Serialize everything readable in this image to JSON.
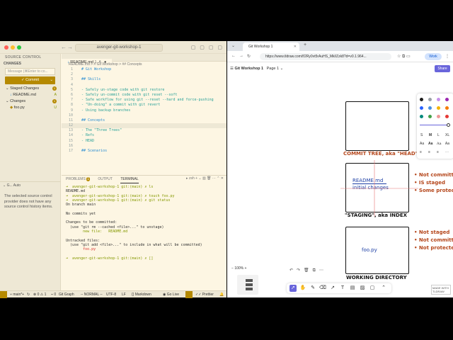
{
  "vscode": {
    "command_center": "avenger-git-workshop-1",
    "sidebar": {
      "title": "SOURCE CONTROL",
      "section": "CHANGES",
      "message_placeholder": "Message (⌘Enter to co...",
      "commit_label": "Commit",
      "staged_label": "Staged Changes",
      "staged_count": "1",
      "staged_file": "README.md",
      "staged_status": "A",
      "changes_label": "Changes",
      "changes_count": "1",
      "changes_file": "foo.py",
      "changes_status": "U",
      "graph_header": "G... Auto",
      "graph_message": "The selected source control provider does not have any source control history items."
    },
    "editor": {
      "tab_label": "README.md",
      "tab_status": "1, A",
      "breadcrumb": "README.md > # Git Workshop > ## Concepts",
      "lines": [
        {
          "n": "1",
          "t": "# Git Workshop",
          "k": "hd"
        },
        {
          "n": "2",
          "t": "",
          "k": ""
        },
        {
          "n": "3",
          "t": "## Skills",
          "k": "hd"
        },
        {
          "n": "4",
          "t": "",
          "k": ""
        },
        {
          "n": "5",
          "t": "- Safely un-stage code with git restore",
          "k": "li"
        },
        {
          "n": "6",
          "t": "- Safely un-commit code with git reset --soft",
          "k": "li"
        },
        {
          "n": "7",
          "t": "- Safe workflow for using git --reset --hard and force-pushing",
          "k": "li"
        },
        {
          "n": "8",
          "t": "- \"Un-doing\" a commit with git revert",
          "k": "li"
        },
        {
          "n": "9",
          "t": "- Using backup branches",
          "k": "li"
        },
        {
          "n": "10",
          "t": "",
          "k": ""
        },
        {
          "n": "11",
          "t": "## Concepts",
          "k": "hd"
        },
        {
          "n": "12",
          "t": "",
          "k": ""
        },
        {
          "n": "13",
          "t": "- The \"Three Trees\"",
          "k": "li"
        },
        {
          "n": "14",
          "t": "- Refs",
          "k": "li"
        },
        {
          "n": "15",
          "t": "- HEAD",
          "k": "li"
        },
        {
          "n": "16",
          "t": "",
          "k": ""
        },
        {
          "n": "17",
          "t": "## Scenarios",
          "k": "hd"
        }
      ]
    },
    "panel": {
      "tabs": [
        "PROBLEMS",
        "OUTPUT",
        "TERMINAL"
      ],
      "problems_count": "1",
      "shell": "zsh",
      "terminal": [
        {
          "t": "➜  avenger-git-workshop-1 git:(main) ✗ ls",
          "k": "g"
        },
        {
          "t": "README.md",
          "k": ""
        },
        {
          "t": "➜  avenger-git-workshop-1 git:(main) ✗ touch foo.py",
          "k": "g"
        },
        {
          "t": "➜  avenger-git-workshop-1 git:(main) ✗ git status",
          "k": "g"
        },
        {
          "t": "On branch main",
          "k": ""
        },
        {
          "t": "",
          "k": ""
        },
        {
          "t": "No commits yet",
          "k": ""
        },
        {
          "t": "",
          "k": ""
        },
        {
          "t": "Changes to be committed:",
          "k": ""
        },
        {
          "t": "  (use \"git rm --cached <file>...\" to unstage)",
          "k": ""
        },
        {
          "t": "        new file:   README.md",
          "k": "g"
        },
        {
          "t": "",
          "k": ""
        },
        {
          "t": "Untracked files:",
          "k": ""
        },
        {
          "t": "  (use \"git add <file>...\" to include in what will be committed)",
          "k": ""
        },
        {
          "t": "        foo.py",
          "k": "r"
        },
        {
          "t": "",
          "k": ""
        },
        {
          "t": "➜  avenger-git-workshop-1 git:(main) ✗ []",
          "k": "g"
        }
      ]
    },
    "status": {
      "branch": "main*+",
      "errors": "0",
      "warnings": "1",
      "ports": "0",
      "git_graph": "Git Graph",
      "mode": "-- NORMAL --",
      "encoding": "UTF-8",
      "eol": "LF",
      "language": "Markdown",
      "golive": "Go Live",
      "prettier": "Prettier"
    }
  },
  "browser": {
    "tab_title": "Git Workshop 1",
    "url": "https://www.tldraw.com/f/2Ry0vt5rAuHS_Mkl/Zzk8?d=v0.1.964...",
    "profile": "Work",
    "doc_title": "Git Workshop 1",
    "page": "Page 1",
    "share": "Share",
    "zoom": "100%",
    "size_options": [
      "S",
      "M",
      "L",
      "XL"
    ],
    "font_options": [
      "Aa",
      "Aa",
      "Aa",
      "Aa"
    ],
    "diagram": {
      "commit_tree_label": "COMMIT TREE, aka \"HEAD\"",
      "staging_label": "\"STAGING\", aka INDEX",
      "working_label": "WORKING DIRECTORY",
      "staging_file": "README.md",
      "staging_note": "initial changes",
      "working_file": "foo.py",
      "notes_staging": [
        "• Not committed",
        "• IS staged",
        "• Some protection"
      ],
      "notes_working": [
        "• Not staged",
        "• Not committed",
        "• Not protected"
      ]
    },
    "made_with": "MADE WITH TLDRAW"
  }
}
